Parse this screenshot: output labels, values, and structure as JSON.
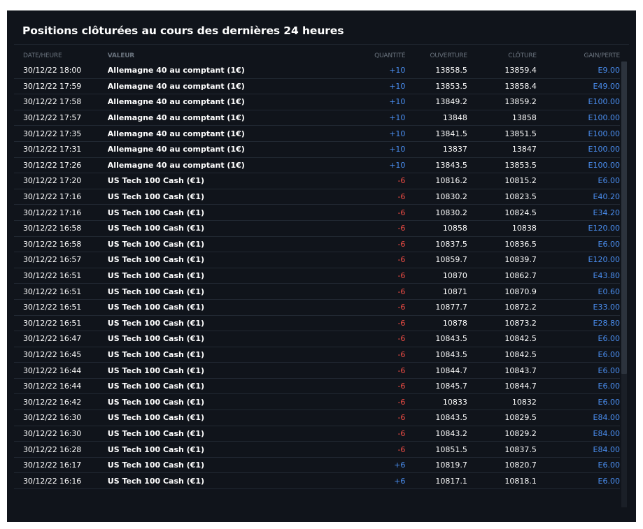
{
  "panel": {
    "title": "Positions clôturées au cours des dernières 24 heures"
  },
  "table": {
    "columns": {
      "date": "DATE/HEURE",
      "value": "VALEUR",
      "qty": "QUANTITÉ",
      "open": "OUVERTURE",
      "close": "CLÔTURE",
      "gain": "GAIN/PERTE"
    },
    "rows": [
      {
        "date": "30/12/22 18:00",
        "name": "Allemagne 40 au comptant (1€)",
        "qty": "+10",
        "dir": "pos",
        "open": "13858.5",
        "close": "13859.4",
        "gain": "E9.00"
      },
      {
        "date": "30/12/22 17:59",
        "name": "Allemagne 40 au comptant (1€)",
        "qty": "+10",
        "dir": "pos",
        "open": "13853.5",
        "close": "13858.4",
        "gain": "E49.00"
      },
      {
        "date": "30/12/22 17:58",
        "name": "Allemagne 40 au comptant (1€)",
        "qty": "+10",
        "dir": "pos",
        "open": "13849.2",
        "close": "13859.2",
        "gain": "E100.00"
      },
      {
        "date": "30/12/22 17:57",
        "name": "Allemagne 40 au comptant (1€)",
        "qty": "+10",
        "dir": "pos",
        "open": "13848",
        "close": "13858",
        "gain": "E100.00"
      },
      {
        "date": "30/12/22 17:35",
        "name": "Allemagne 40 au comptant (1€)",
        "qty": "+10",
        "dir": "pos",
        "open": "13841.5",
        "close": "13851.5",
        "gain": "E100.00"
      },
      {
        "date": "30/12/22 17:31",
        "name": "Allemagne 40 au comptant (1€)",
        "qty": "+10",
        "dir": "pos",
        "open": "13837",
        "close": "13847",
        "gain": "E100.00"
      },
      {
        "date": "30/12/22 17:26",
        "name": "Allemagne 40 au comptant (1€)",
        "qty": "+10",
        "dir": "pos",
        "open": "13843.5",
        "close": "13853.5",
        "gain": "E100.00"
      },
      {
        "date": "30/12/22 17:20",
        "name": "US Tech 100 Cash (€1)",
        "qty": "-6",
        "dir": "neg",
        "open": "10816.2",
        "close": "10815.2",
        "gain": "E6.00"
      },
      {
        "date": "30/12/22 17:16",
        "name": "US Tech 100 Cash (€1)",
        "qty": "-6",
        "dir": "neg",
        "open": "10830.2",
        "close": "10823.5",
        "gain": "E40.20"
      },
      {
        "date": "30/12/22 17:16",
        "name": "US Tech 100 Cash (€1)",
        "qty": "-6",
        "dir": "neg",
        "open": "10830.2",
        "close": "10824.5",
        "gain": "E34.20"
      },
      {
        "date": "30/12/22 16:58",
        "name": "US Tech 100 Cash (€1)",
        "qty": "-6",
        "dir": "neg",
        "open": "10858",
        "close": "10838",
        "gain": "E120.00"
      },
      {
        "date": "30/12/22 16:58",
        "name": "US Tech 100 Cash (€1)",
        "qty": "-6",
        "dir": "neg",
        "open": "10837.5",
        "close": "10836.5",
        "gain": "E6.00"
      },
      {
        "date": "30/12/22 16:57",
        "name": "US Tech 100 Cash (€1)",
        "qty": "-6",
        "dir": "neg",
        "open": "10859.7",
        "close": "10839.7",
        "gain": "E120.00"
      },
      {
        "date": "30/12/22 16:51",
        "name": "US Tech 100 Cash (€1)",
        "qty": "-6",
        "dir": "neg",
        "open": "10870",
        "close": "10862.7",
        "gain": "E43.80"
      },
      {
        "date": "30/12/22 16:51",
        "name": "US Tech 100 Cash (€1)",
        "qty": "-6",
        "dir": "neg",
        "open": "10871",
        "close": "10870.9",
        "gain": "E0.60"
      },
      {
        "date": "30/12/22 16:51",
        "name": "US Tech 100 Cash (€1)",
        "qty": "-6",
        "dir": "neg",
        "open": "10877.7",
        "close": "10872.2",
        "gain": "E33.00"
      },
      {
        "date": "30/12/22 16:51",
        "name": "US Tech 100 Cash (€1)",
        "qty": "-6",
        "dir": "neg",
        "open": "10878",
        "close": "10873.2",
        "gain": "E28.80"
      },
      {
        "date": "30/12/22 16:47",
        "name": "US Tech 100 Cash (€1)",
        "qty": "-6",
        "dir": "neg",
        "open": "10843.5",
        "close": "10842.5",
        "gain": "E6.00"
      },
      {
        "date": "30/12/22 16:45",
        "name": "US Tech 100 Cash (€1)",
        "qty": "-6",
        "dir": "neg",
        "open": "10843.5",
        "close": "10842.5",
        "gain": "E6.00"
      },
      {
        "date": "30/12/22 16:44",
        "name": "US Tech 100 Cash (€1)",
        "qty": "-6",
        "dir": "neg",
        "open": "10844.7",
        "close": "10843.7",
        "gain": "E6.00"
      },
      {
        "date": "30/12/22 16:44",
        "name": "US Tech 100 Cash (€1)",
        "qty": "-6",
        "dir": "neg",
        "open": "10845.7",
        "close": "10844.7",
        "gain": "E6.00"
      },
      {
        "date": "30/12/22 16:42",
        "name": "US Tech 100 Cash (€1)",
        "qty": "-6",
        "dir": "neg",
        "open": "10833",
        "close": "10832",
        "gain": "E6.00"
      },
      {
        "date": "30/12/22 16:30",
        "name": "US Tech 100 Cash (€1)",
        "qty": "-6",
        "dir": "neg",
        "open": "10843.5",
        "close": "10829.5",
        "gain": "E84.00"
      },
      {
        "date": "30/12/22 16:30",
        "name": "US Tech 100 Cash (€1)",
        "qty": "-6",
        "dir": "neg",
        "open": "10843.2",
        "close": "10829.2",
        "gain": "E84.00"
      },
      {
        "date": "30/12/22 16:28",
        "name": "US Tech 100 Cash (€1)",
        "qty": "-6",
        "dir": "neg",
        "open": "10851.5",
        "close": "10837.5",
        "gain": "E84.00"
      },
      {
        "date": "30/12/22 16:17",
        "name": "US Tech 100 Cash (€1)",
        "qty": "+6",
        "dir": "pos",
        "open": "10819.7",
        "close": "10820.7",
        "gain": "E6.00"
      },
      {
        "date": "30/12/22 16:16",
        "name": "US Tech 100 Cash (€1)",
        "qty": "+6",
        "dir": "pos",
        "open": "10817.1",
        "close": "10818.1",
        "gain": "E6.00"
      }
    ]
  },
  "colors": {
    "background": "#10141b",
    "positive": "#4a8ef0",
    "negative": "#ef4c44",
    "header_text": "#6a737e"
  }
}
